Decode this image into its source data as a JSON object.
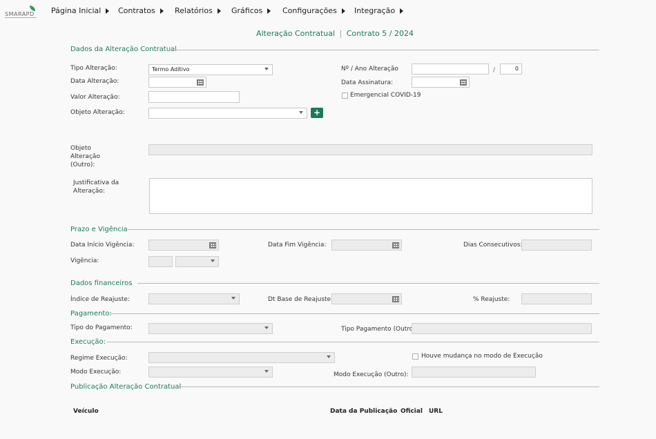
{
  "logo": {
    "text": "SMARAPD"
  },
  "nav": [
    {
      "label": "Página Inicial"
    },
    {
      "label": "Contratos"
    },
    {
      "label": "Relatórios"
    },
    {
      "label": "Gráficos"
    },
    {
      "label": "Configurações"
    },
    {
      "label": "Integração"
    }
  ],
  "title": {
    "main": "Alteração Contratual",
    "sep": "|",
    "sub": "Contrato 5  /  2024"
  },
  "dados": {
    "section": "Dados da Alteração Contratual",
    "tipo_label": "Tipo Alteração:",
    "tipo_value": "Termo Aditivo",
    "data_label": "Data Alteração:",
    "data_value": "",
    "valor_label": "Valor Alteração:",
    "valor_value": "",
    "objeto_label": "Objeto Alteração:",
    "objeto_value": "",
    "add_label": "+",
    "numero_label": "Nº / Ano Alteração",
    "numero_value": "",
    "slash": "/",
    "ano_value": "0",
    "assinatura_label": "Data Assinatura:",
    "assinatura_value": "",
    "covid_label": "Emergencial COVID-19",
    "outro_label": "Objeto Alteração (Outro):",
    "outro_value": "",
    "justificativa_label": "Justificativa da Alteração:",
    "justificativa_value": ""
  },
  "prazo": {
    "section": "Prazo e Vigência",
    "inicio_label": "Data Início Vigência:",
    "fim_label": "Data Fim Vigência:",
    "dias_label": "Dias Consecutivos:",
    "vigencia_label": "Vigência:"
  },
  "financeiro": {
    "section": "Dados financeiros",
    "indice_label": "Índice de Reajuste:",
    "dtbase_label": "Dt Base de Reajuste:",
    "reajuste_label": "% Reajuste:"
  },
  "pagamento": {
    "section": "Pagamento:",
    "tipo_label": "Tipo do Pagamento:",
    "outro_label": "Tipo Pagamento (Outro):"
  },
  "execucao": {
    "section": "Execução:",
    "regime_label": "Regime Execução:",
    "mudanca_label": "Houve mudança no modo de Execução",
    "modo_label": "Modo Execução:",
    "modo_outro_label": "Modo Execução (Outro):"
  },
  "publicacao": {
    "section": "Publicação Alteração Contratual",
    "columns": [
      "Veículo",
      "Data da Publicação",
      "Oficial",
      "URL"
    ]
  },
  "colors": {
    "accent": "#1b7a5e"
  }
}
